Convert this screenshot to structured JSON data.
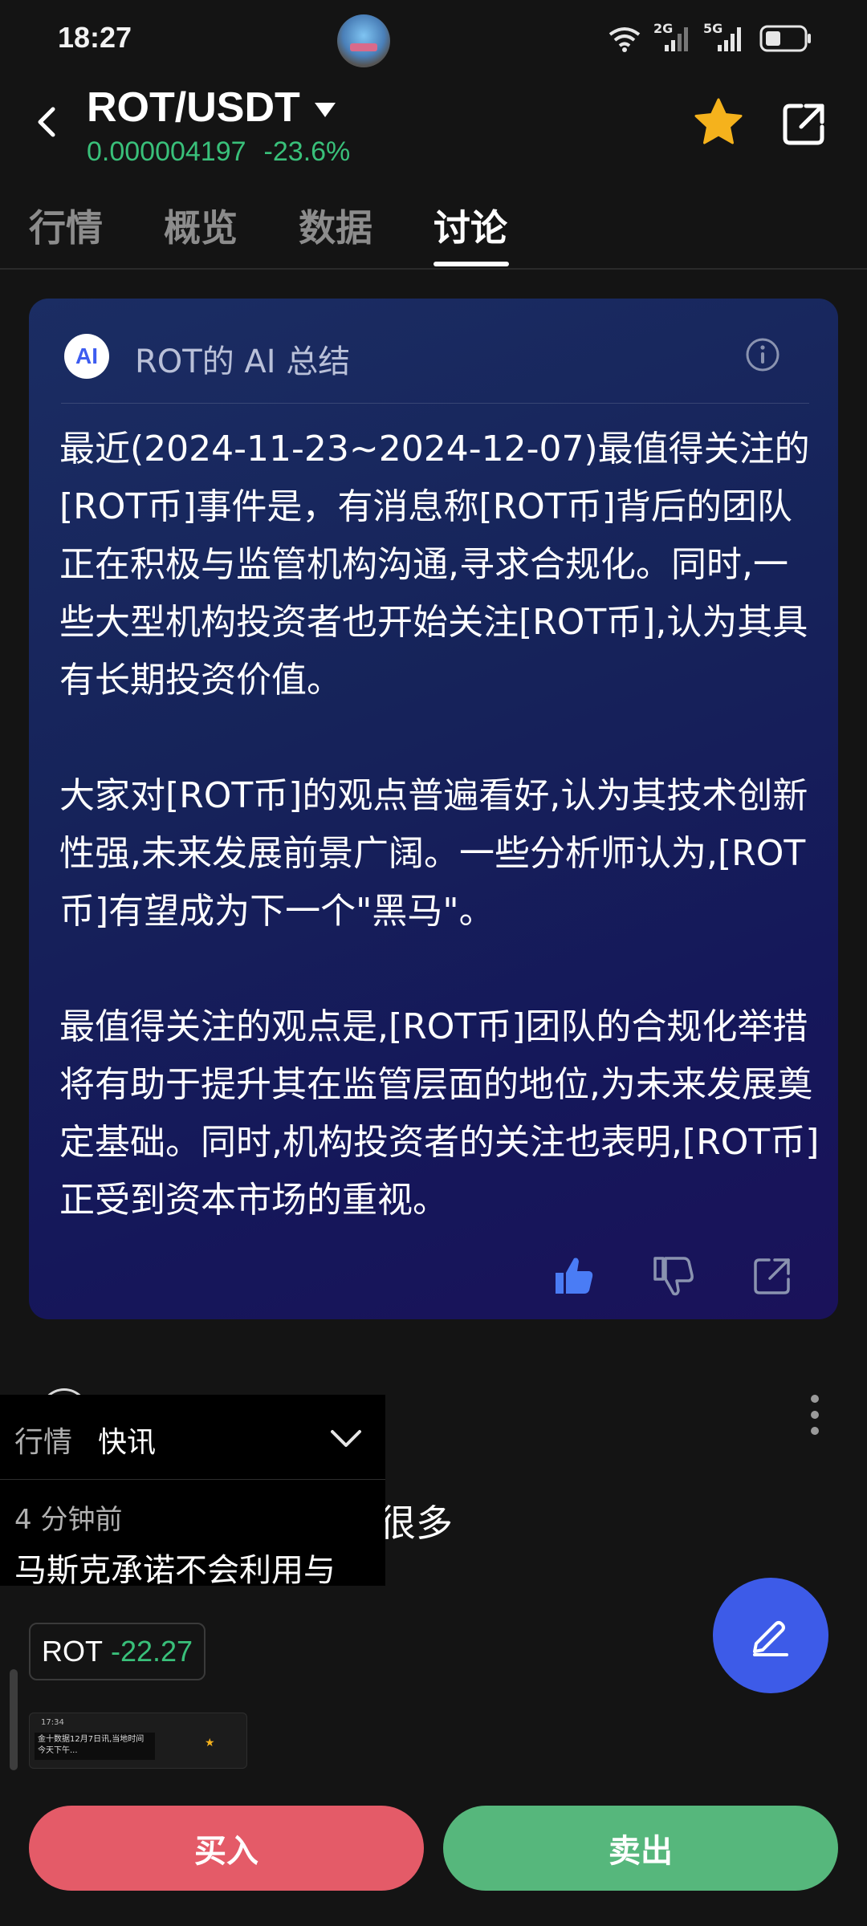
{
  "status_bar": {
    "time": "18:27",
    "network_2g": "2G",
    "network_5g": "5G"
  },
  "header": {
    "pair": "ROT/USDT",
    "price": "0.000004197",
    "change": "-23.6%",
    "favorite_color": "#F5B21C"
  },
  "tabs": [
    {
      "label": "行情",
      "active": false
    },
    {
      "label": "概览",
      "active": false
    },
    {
      "label": "数据",
      "active": false
    },
    {
      "label": "讨论",
      "active": true
    }
  ],
  "ai_card": {
    "badge": "AI",
    "title": "ROT的 AI 总结",
    "paragraphs": [
      "最近(2024-11-23~2024-12-07)最值得关注的[ROT币]事件是，有消息称[ROT币]背后的团队正在积极与监管机构沟通,寻求合规化。同时,一些大型机构投资者也开始关注[ROT币],认为其具有长期投资价值。",
      "大家对[ROT币]的观点普遍看好,认为其技术创新性强,未来发展前景广阔。一些分析师认为,[ROT币]有望成为下一个\"黑马\"。",
      "最值得关注的观点是,[ROT币]团队的合规化举措将有助于提升其在监管层面的地位,为未来发展奠定基础。同时,机构投资者的关注也表明,[ROT币]正受到资本市场的重视。"
    ]
  },
  "news_float": {
    "tab_market": "行情",
    "tab_flash": "快讯",
    "time_ago": "4 分钟前",
    "headline": "马斯克承诺不会利用与"
  },
  "post": {
    "text_tail": "很多",
    "ticker": "ROT",
    "ticker_change": "-22.27",
    "thumb_time": "17:34",
    "thumb_text": "金十数据12月7日讯,当地时间今天下午..."
  },
  "actions": {
    "buy": "买入",
    "sell": "卖出"
  },
  "colors": {
    "up_green": "#39C07A",
    "buy_red": "#E45B68",
    "sell_green": "#56B77C",
    "fab_blue": "#3D5BE8",
    "like_blue": "#4A7CF5"
  }
}
